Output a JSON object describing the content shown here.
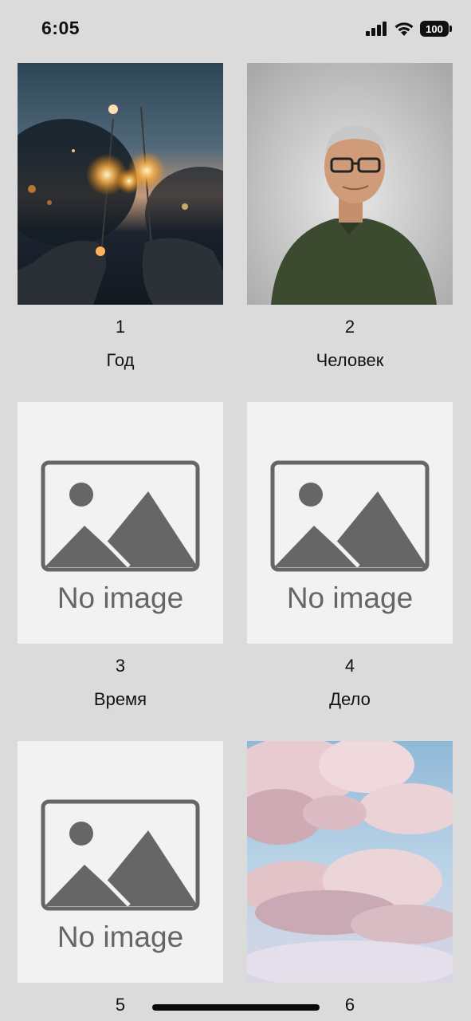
{
  "status_bar": {
    "time": "6:05",
    "battery": "100"
  },
  "items": [
    {
      "number": "1",
      "title": "Год",
      "image": "sparklers-photo"
    },
    {
      "number": "2",
      "title": "Человек",
      "image": "man-portrait-photo"
    },
    {
      "number": "3",
      "title": "Время",
      "image": "no-image-placeholder",
      "placeholder_text": "No image"
    },
    {
      "number": "4",
      "title": "Дело",
      "image": "no-image-placeholder",
      "placeholder_text": "No image"
    },
    {
      "number": "5",
      "title": "",
      "image": "no-image-placeholder",
      "placeholder_text": "No image"
    },
    {
      "number": "6",
      "title": "",
      "image": "clouds-photo"
    }
  ]
}
